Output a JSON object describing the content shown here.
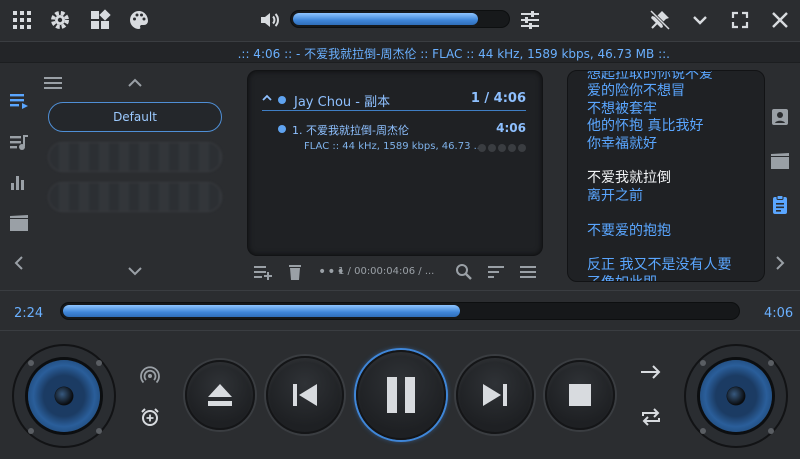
{
  "topbar": {
    "icons_left": [
      "grid-menu-icon",
      "gear-icon",
      "layout-icon",
      "palette-icon"
    ],
    "volume_icon": "speaker-icon",
    "volume_level": 0.87,
    "eq_icon": "equalizer-sliders-icon",
    "icons_right": [
      "pin-off-icon",
      "chevron-down-icon",
      "fullscreen-icon",
      "close-icon"
    ]
  },
  "info_line": ".:: 4:06 ::  - 不爱我就拉倒-周杰伦 :: FLAC :: 44 kHz, 1589 kbps, 46.73 MB ::.",
  "left_rail": [
    "playlist-icon",
    "queue-music-icon",
    "bar-chart-icon",
    "video-icon",
    "chevron-left-icon"
  ],
  "presets": {
    "default_label": "Default"
  },
  "playlist": {
    "group_name": "Jay Chou - 副本",
    "group_count": "1 / 4:06",
    "track_title": "1. 不爱我就拉倒-周杰伦",
    "track_duration": "4:06",
    "track_info": "FLAC :: 44 kHz, 1589 kbps, 46.73 ...",
    "rating_max": 5,
    "rating": 0,
    "tools_time": "1 / 00:00:04:06 / ..."
  },
  "lyrics": {
    "lines": [
      {
        "text": "想起拉取的你说不爱",
        "current": false
      },
      {
        "text": "爱的险你不想冒",
        "current": false
      },
      {
        "text": "不想被套牢",
        "current": false
      },
      {
        "text": "他的怀抱 真比我好",
        "current": false
      },
      {
        "text": "你幸福就好",
        "current": false
      },
      {
        "text": "",
        "current": false
      },
      {
        "text": "不爱我就拉倒",
        "current": true
      },
      {
        "text": "离开之前",
        "current": false
      },
      {
        "text": "",
        "current": false
      },
      {
        "text": "不要爱的抱抱",
        "current": false
      },
      {
        "text": "",
        "current": false
      },
      {
        "text": "反正 我又不是没有人要",
        "current": false
      },
      {
        "text": "了像如此即",
        "current": false
      }
    ]
  },
  "right_rail": [
    "contact-icon",
    "video-icon",
    "clipboard-icon",
    "chevron-right-icon"
  ],
  "progress": {
    "elapsed": "2:24",
    "total": "4:06",
    "fraction": 0.585
  },
  "transport": {
    "buttons": [
      "eject-icon",
      "previous-icon",
      "pause-icon",
      "next-icon",
      "stop-icon"
    ],
    "left_small": [
      "broadcast-icon",
      "alarm-add-icon"
    ],
    "right_small": [
      "arrow-right-icon",
      "repeat-icon"
    ]
  },
  "colors": {
    "accent": "#3f86d8",
    "text_blue": "#5aa6ff",
    "panel": "#1f2124",
    "bg": "#2b2d30"
  }
}
